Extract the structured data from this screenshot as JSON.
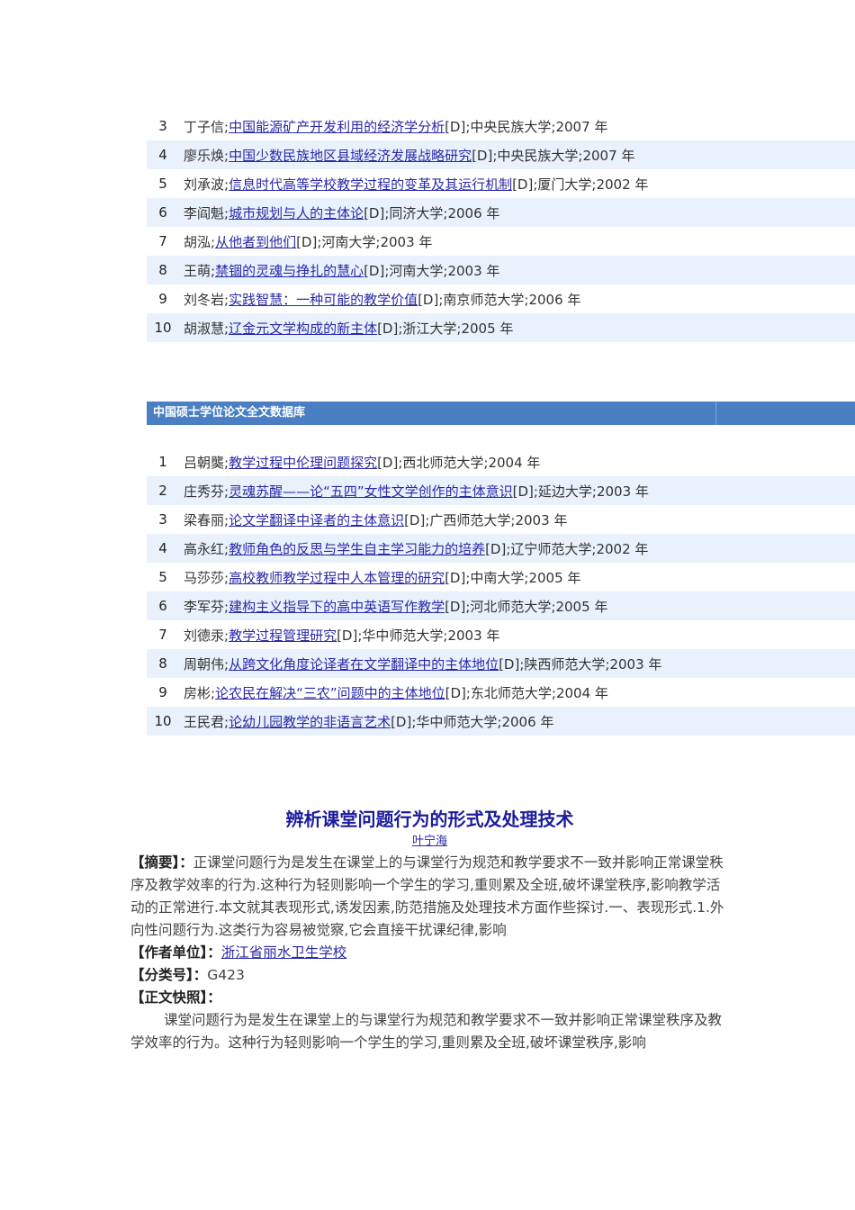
{
  "list1": [
    {
      "n": "3",
      "author": "丁子信;",
      "title": "中国能源矿产开发利用的经济学分析",
      "rest": "[D];中央民族大学;2007 年"
    },
    {
      "n": "4",
      "author": "廖乐焕;",
      "title": "中国少数民族地区县域经济发展战略研究",
      "rest": "[D];中央民族大学;2007 年"
    },
    {
      "n": "5",
      "author": "刘承波;",
      "title": "信息时代高等学校教学过程的变革及其运行机制",
      "rest": "[D];厦门大学;2002 年"
    },
    {
      "n": "6",
      "author": "李阎魁;",
      "title": "城市规划与人的主体论",
      "rest": "[D];同济大学;2006 年"
    },
    {
      "n": "7",
      "author": "胡泓;",
      "title": "从他者到他们",
      "rest": "[D];河南大学;2003 年"
    },
    {
      "n": "8",
      "author": "王萌;",
      "title": "禁锢的灵魂与挣扎的慧心",
      "rest": "[D];河南大学;2003 年"
    },
    {
      "n": "9",
      "author": "刘冬岩;",
      "title": "实践智慧：一种可能的教学价值",
      "rest": "[D];南京师范大学;2006 年"
    },
    {
      "n": "10",
      "author": "胡淑慧;",
      "title": "辽金元文学构成的新主体",
      "rest": "[D];浙江大学;2005 年"
    }
  ],
  "section_header": "中国硕士学位论文全文数据库",
  "list2": [
    {
      "n": "1",
      "author": "吕朝龑;",
      "title": "教学过程中伦理问题探究",
      "rest": "[D];西北师范大学;2004 年"
    },
    {
      "n": "2",
      "author": "庄秀芬;",
      "title": "灵魂苏醒——论“五四”女性文学创作的主体意识",
      "rest": "[D];延边大学;2003 年"
    },
    {
      "n": "3",
      "author": "梁春丽;",
      "title": "论文学翻译中译者的主体意识",
      "rest": "[D];广西师范大学;2003 年"
    },
    {
      "n": "4",
      "author": "高永红;",
      "title": "教师角色的反思与学生自主学习能力的培养",
      "rest": "[D];辽宁师范大学;2002 年"
    },
    {
      "n": "5",
      "author": "马莎莎;",
      "title": "高校教师教学过程中人本管理的研究",
      "rest": "[D];中南大学;2005 年"
    },
    {
      "n": "6",
      "author": "李军芬;",
      "title": "建构主义指导下的高中英语写作教学",
      "rest": "[D];河北师范大学;2005 年"
    },
    {
      "n": "7",
      "author": "刘德汞;",
      "title": "教学过程管理研究",
      "rest": "[D];华中师范大学;2003 年"
    },
    {
      "n": "8",
      "author": "周朝伟;",
      "title": "从跨文化角度论译者在文学翻译中的主体地位",
      "rest": "[D];陕西师范大学;2003 年"
    },
    {
      "n": "9",
      "author": "房彬;",
      "title": "论农民在解决“三农”问题中的主体地位",
      "rest": "[D];东北师范大学;2004 年"
    },
    {
      "n": "10",
      "author": "王民君;",
      "title": "论幼儿园教学的非语言艺术",
      "rest": "[D];华中师范大学;2006 年"
    }
  ],
  "article": {
    "title": "辨析课堂问题行为的形式及处理技术",
    "author": "叶宁海",
    "abstract_label": "【摘要】：",
    "abstract": "正课堂问题行为是发生在课堂上的与课堂行为规范和教学要求不一致并影响正常课堂秩序及教学效率的行为.这种行为轻则影响一个学生的学习,重则累及全班,破坏课堂秩序,影响教学活动的正常进行.本文就其表现形式,诱发因素,防范措施及处理技术方面作些探讨.一、表现形式.1.外向性问题行为.这类行为容易被觉察,它会直接干扰课纪律,影响",
    "unit_label": "【作者单位】：",
    "unit": "浙江省丽水卫生学校",
    "class_label": "【分类号】：",
    "class": "G423",
    "snapshot_label": "【正文快照】：",
    "snapshot": "课堂问题行为是发生在课堂上的与课堂行为规范和教学要求不一致并影响正常课堂秩序及教学效率的行为。这种行为轻则影响一个学生的学习,重则累及全班,破坏课堂秩序,影响"
  }
}
